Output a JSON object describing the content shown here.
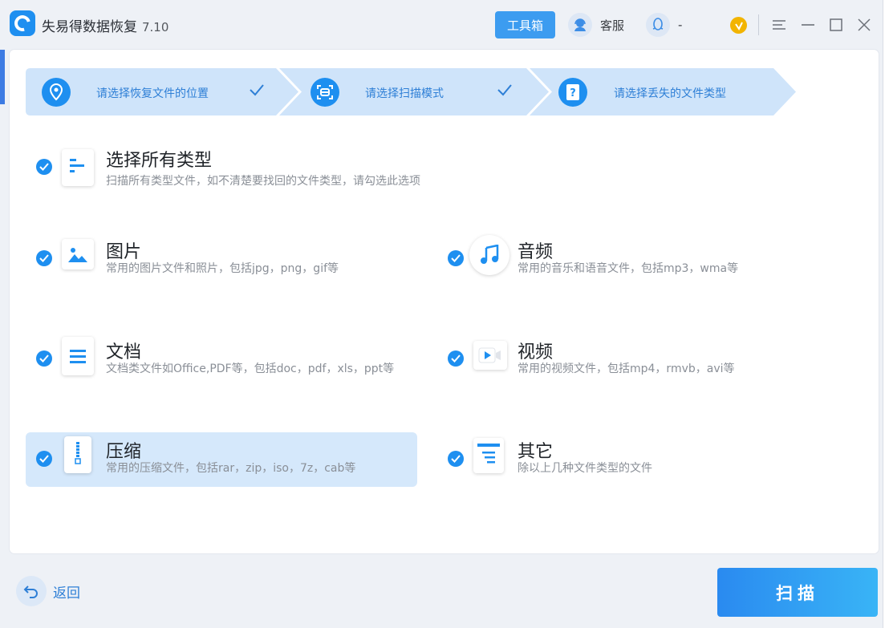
{
  "app": {
    "title": "失易得数据恢复",
    "version": "7.10"
  },
  "header": {
    "toolbox_label": "工具箱",
    "service_label": "客服",
    "qq_label": "-"
  },
  "steps": [
    {
      "label": "请选择恢复文件的位置",
      "icon": "location-pin-icon",
      "done": true
    },
    {
      "label": "请选择扫描模式",
      "icon": "scan-icon",
      "done": true
    },
    {
      "label": "请选择丢失的文件类型",
      "icon": "question-icon",
      "done": false
    }
  ],
  "options": {
    "all": {
      "title": "选择所有类型",
      "desc": "扫描所有类型文件，如不清楚要找回的文件类型，请勾选此选项",
      "checked": true
    },
    "images": {
      "title": "图片",
      "desc": "常用的图片文件和照片，包括jpg，png，gif等",
      "checked": true
    },
    "audio": {
      "title": "音频",
      "desc": "常用的音乐和语音文件，包括mp3，wma等",
      "checked": true
    },
    "documents": {
      "title": "文档",
      "desc": "文档类文件如Office,PDF等，包括doc，pdf，xls，ppt等",
      "checked": true
    },
    "video": {
      "title": "视频",
      "desc": "常用的视频文件，包括mp4，rmvb，avi等",
      "checked": true
    },
    "archive": {
      "title": "压缩",
      "desc": "常用的压缩文件，包括rar，zip，iso，7z，cab等",
      "checked": true
    },
    "other": {
      "title": "其它",
      "desc": "除以上几种文件类型的文件",
      "checked": true
    }
  },
  "footer": {
    "back_label": "返回",
    "scan_label": "扫描"
  },
  "colors": {
    "accent": "#1e8ff0",
    "selected_bg": "#d5e8fb",
    "step_bg": "#cfe4fa"
  }
}
